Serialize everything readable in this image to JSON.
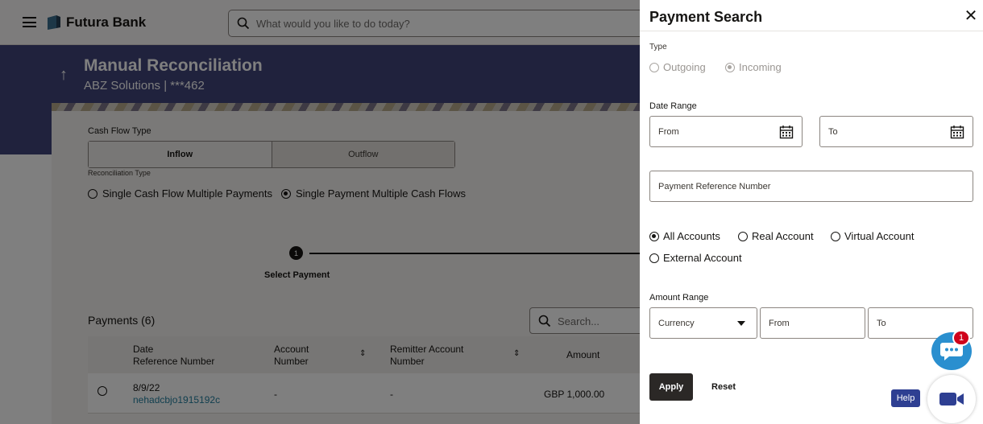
{
  "app": {
    "brand": "Futura Bank",
    "search_placeholder": "What would you like to do today?"
  },
  "page": {
    "title": "Manual Reconciliation",
    "subtitle": "ABZ Solutions | ***462"
  },
  "form": {
    "cash_flow_label": "Cash Flow Type",
    "cash_flow_options": [
      "Inflow",
      "Outflow"
    ],
    "cash_flow_selected": "Inflow",
    "recon_type_label": "Reconciliation Type",
    "recon_options": [
      "Single Cash Flow Multiple Payments",
      "Single Payment Multiple Cash Flows"
    ],
    "recon_selected": "Single Payment Multiple Cash Flows"
  },
  "stepper": {
    "step_number": "1",
    "step_label": "Select Payment"
  },
  "payments": {
    "heading": "Payments (6)",
    "search_placeholder": "Search...",
    "columns": [
      {
        "line1": "Date",
        "line2": "Reference Number"
      },
      {
        "line1": "Account",
        "line2": "Number"
      },
      {
        "line1": "Remitter Account",
        "line2": "Number"
      },
      {
        "line1": "Amount",
        "line2": ""
      }
    ],
    "rows": [
      {
        "date": "8/9/22",
        "reference": "nehadcbjo1915192c",
        "account": "-",
        "remitter": "-",
        "amount": "GBP 1,000.00"
      }
    ]
  },
  "drawer": {
    "title": "Payment Search",
    "close_glyph": "✕",
    "type_label": "Type",
    "type_options": [
      "Outgoing",
      "Incoming"
    ],
    "type_selected": "Incoming",
    "date_range_label": "Date Range",
    "date_from_placeholder": "From",
    "date_to_placeholder": "To",
    "payment_ref_placeholder": "Payment Reference Number",
    "account_options": [
      "All Accounts",
      "Real Account",
      "Virtual Account",
      "External Account"
    ],
    "account_selected": "All Accounts",
    "amount_range_label": "Amount Range",
    "currency_placeholder": "Currency",
    "amount_from_placeholder": "From",
    "amount_to_placeholder": "To",
    "apply_label": "Apply",
    "reset_label": "Reset"
  },
  "widgets": {
    "chat_badge_count": "1",
    "help_label": "Help"
  },
  "colors": {
    "banner": "#41447a",
    "link": "#227e9e",
    "chat": "#2a8fcf",
    "help": "#2e3f92",
    "badge": "#d0021b"
  }
}
